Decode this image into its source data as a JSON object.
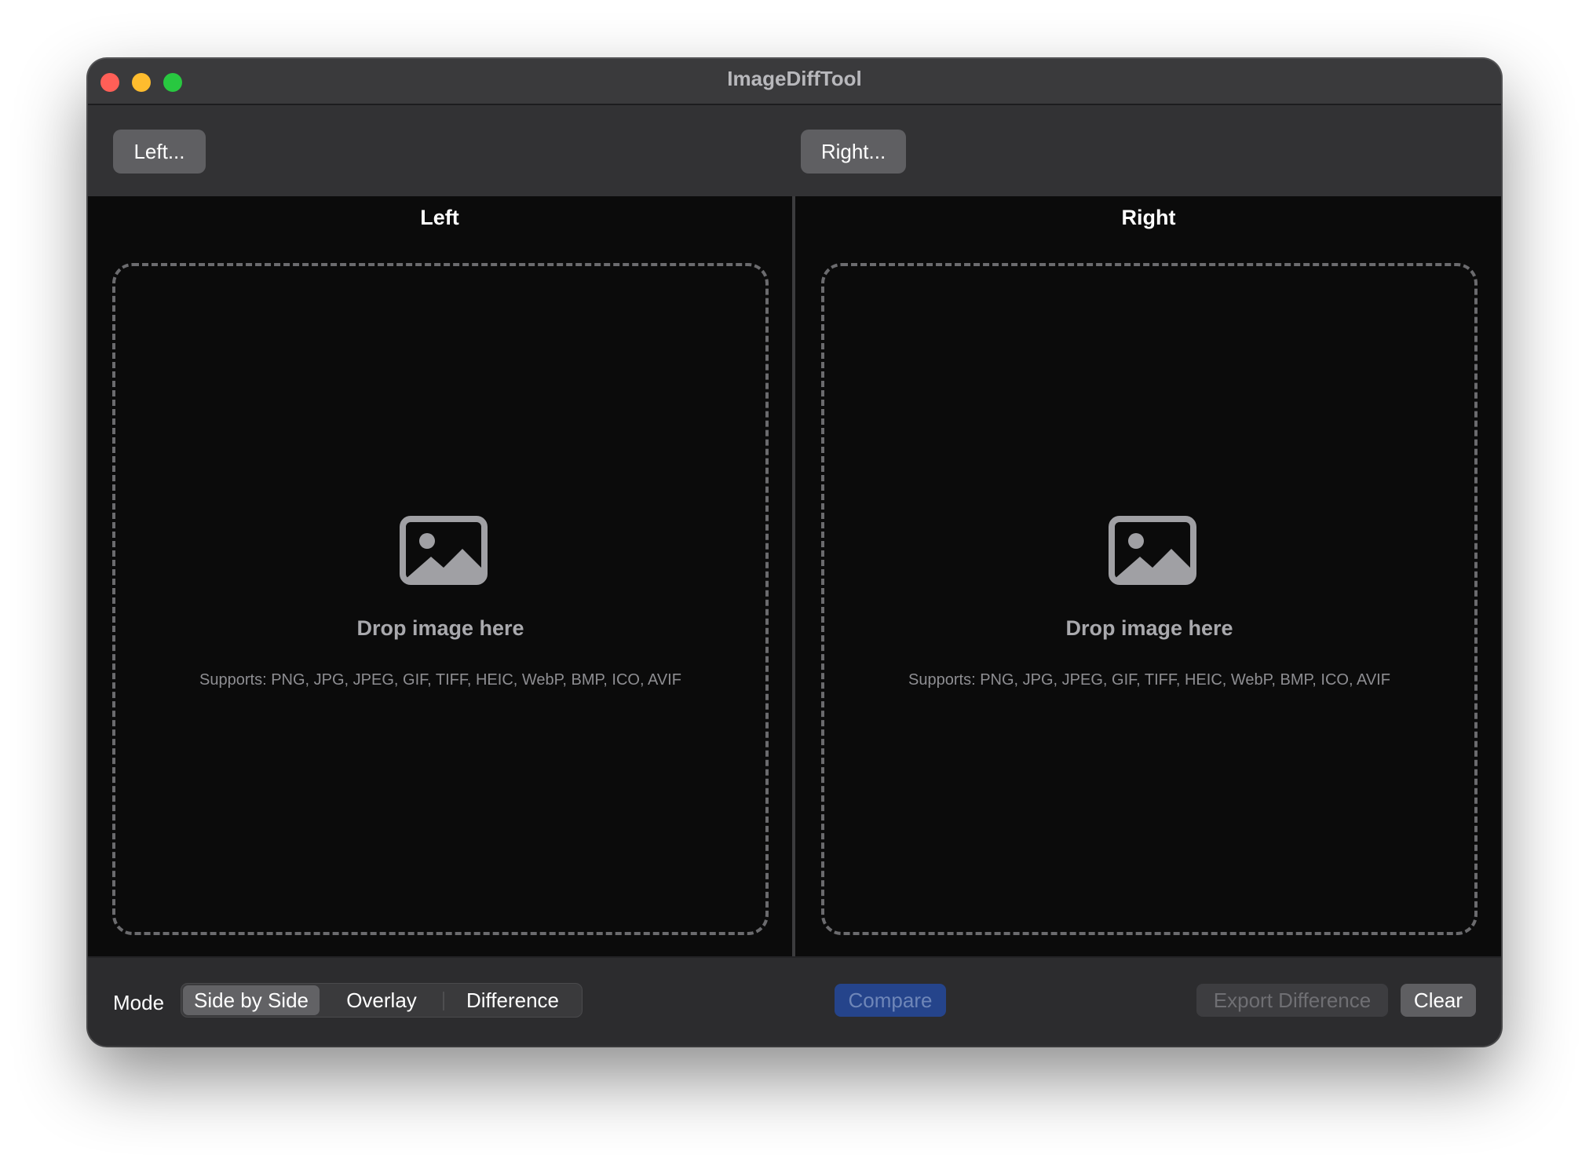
{
  "window": {
    "title": "ImageDiffTool",
    "controls": [
      "close",
      "minimize",
      "zoom"
    ]
  },
  "toolbar": {
    "left_button": "Left...",
    "right_button": "Right..."
  },
  "panes": {
    "left": {
      "title": "Left",
      "drop_text": "Drop image here",
      "formats": "Supports: PNG, JPG, JPEG, GIF, TIFF, HEIC, WebP, BMP, ICO, AVIF",
      "icon": "photo-icon"
    },
    "right": {
      "title": "Right",
      "drop_text": "Drop image here",
      "formats": "Supports: PNG, JPG, JPEG, GIF, TIFF, HEIC, WebP, BMP, ICO, AVIF",
      "icon": "photo-icon"
    }
  },
  "bottom": {
    "mode_label": "Mode",
    "modes": [
      "Side by Side",
      "Overlay",
      "Difference"
    ],
    "selected_mode": "Side by Side",
    "compare_label": "Compare",
    "export_label": "Export Difference",
    "clear_label": "Clear"
  },
  "colors": {
    "accent": "#25448b",
    "close": "#ff5f57",
    "minimize": "#febc2e",
    "zoom": "#28c840"
  }
}
